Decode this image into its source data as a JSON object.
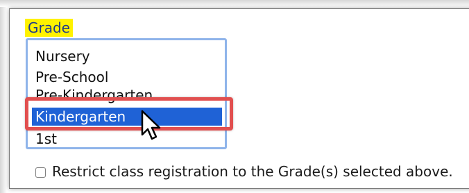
{
  "grade_field": {
    "label": "Grade",
    "options": [
      "Nursery",
      "Pre-School",
      "Pre-Kindergarten",
      "Kindergarten",
      "1st"
    ],
    "selected": "Kindergarten"
  },
  "restrict_checkbox": {
    "label": "Restrict class registration to the Grade(s) selected above.",
    "checked": false
  },
  "colors": {
    "label_highlight": "#fff200",
    "listbox_border": "#8fb4ea",
    "selection": "#1f62d6",
    "annotation_box": "#e14f4f"
  },
  "icons": {
    "cursor": "mouse-pointer-icon"
  }
}
